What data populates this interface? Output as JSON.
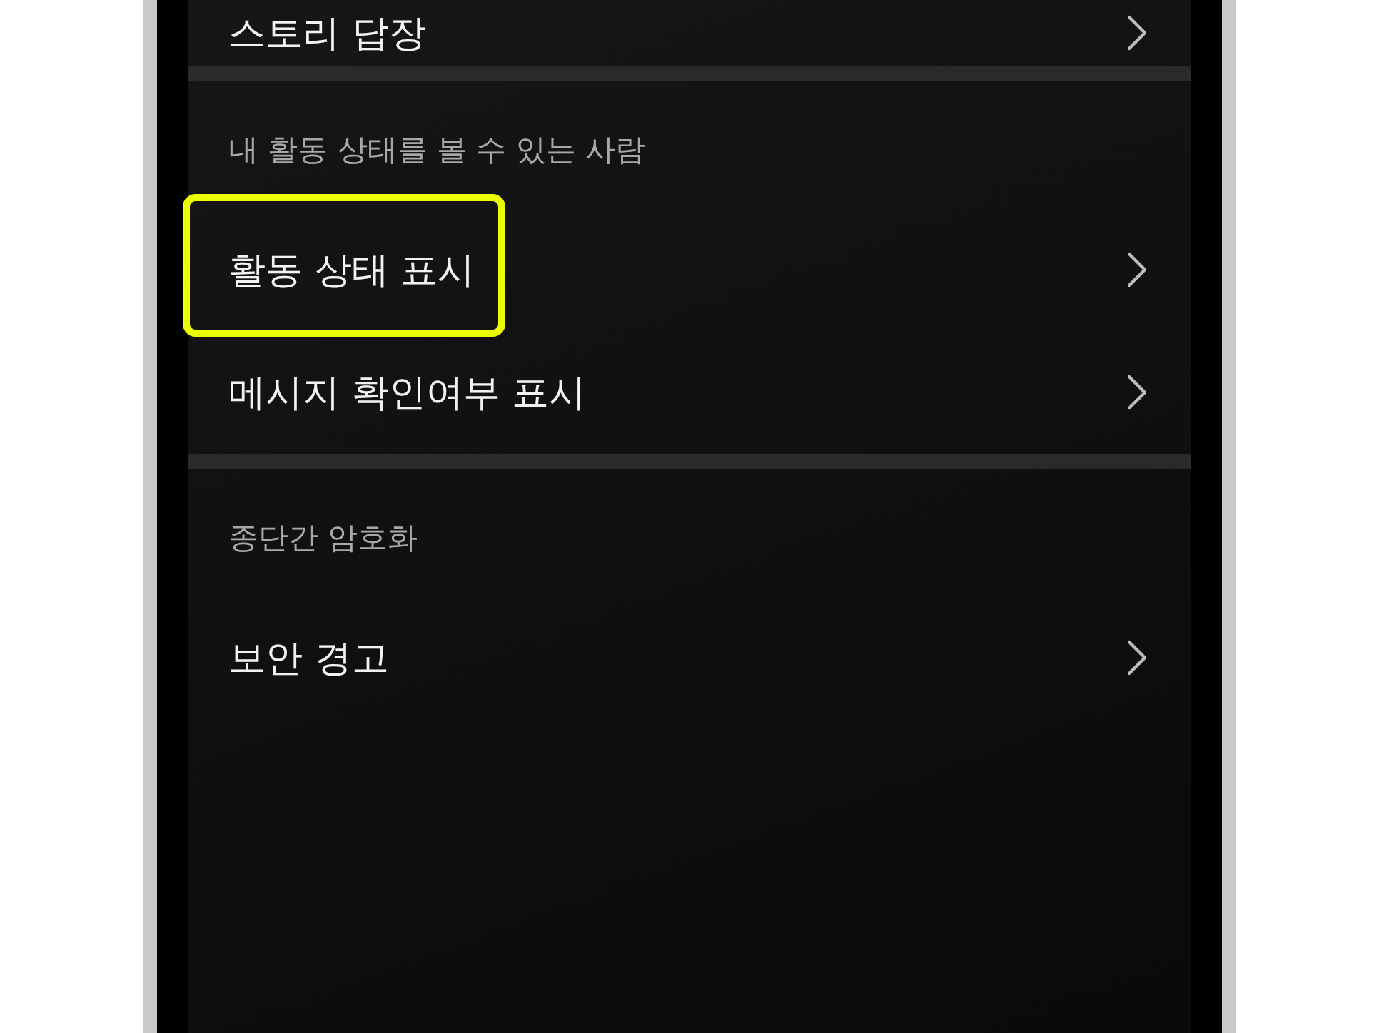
{
  "sections": [
    {
      "items": [
        {
          "label": "스토리 답장",
          "highlighted": false
        }
      ]
    },
    {
      "header": "내 활동 상태를 볼 수 있는 사람",
      "items": [
        {
          "label": "활동 상태 표시",
          "highlighted": true
        },
        {
          "label": "메시지 확인여부 표시",
          "highlighted": false
        }
      ]
    },
    {
      "header": "종단간 암호화",
      "items": [
        {
          "label": "보안 경고",
          "highlighted": false
        }
      ]
    }
  ]
}
